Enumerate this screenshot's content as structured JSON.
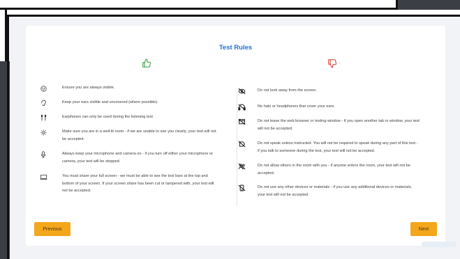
{
  "title": "Test Rules",
  "icons": {
    "allowed": "thumbs-up-icon",
    "disallowed": "thumbs-down-icon"
  },
  "colors": {
    "title": "#1e6fd9",
    "thumbs_up": "#2f9d3c",
    "thumbs_down": "#d9392e",
    "button": "#f4a61c"
  },
  "do_rules": [
    {
      "icon": "smiley-icon",
      "text": "Ensure you are always visible."
    },
    {
      "icon": "ear-icon",
      "text": "Keep your ears visible and uncovered (where possible)."
    },
    {
      "icon": "earphones-icon",
      "text": "Earphones can only be used during the listening test"
    },
    {
      "icon": "light-icon",
      "text": "Make sure you are in a well-lit room - if we are unable to see you clearly, your test will not be accepted."
    },
    {
      "icon": "microphone-icon",
      "text": "Always keep your microphone and camera on - if you turn off either your microphone or camera, your test will be stopped."
    },
    {
      "icon": "laptop-icon",
      "text": "You must share your full screen - we must be able to see the tool bars at the top and bottom of your screen. If your screen share has been cut or tampered with, your test will not be accepted."
    }
  ],
  "dont_rules": [
    {
      "icon": "no-look-away-icon",
      "text": "Do not look away from the screen."
    },
    {
      "icon": "no-headphones-icon",
      "text": "No hats or headphones that cover your ears."
    },
    {
      "icon": "no-leave-window-icon",
      "text": "Do not leave the web browser or testing window - if you open another tab or window, your test will not be accepted."
    },
    {
      "icon": "no-speaking-icon",
      "text": "Do not speak unless instructed. You will not be required to speak during any part of this test - if you talk to someone during the test, your test will not be accepted."
    },
    {
      "icon": "no-others-icon",
      "text": "Do not allow others in the room with you - if anyone enters the room, your test will not be accepted."
    },
    {
      "icon": "no-devices-icon",
      "text": "Do not use any other devices or materials - if you use any additional devices or materials, your test will not be accepted."
    }
  ],
  "buttons": {
    "previous": "Previous",
    "next": "Next"
  }
}
